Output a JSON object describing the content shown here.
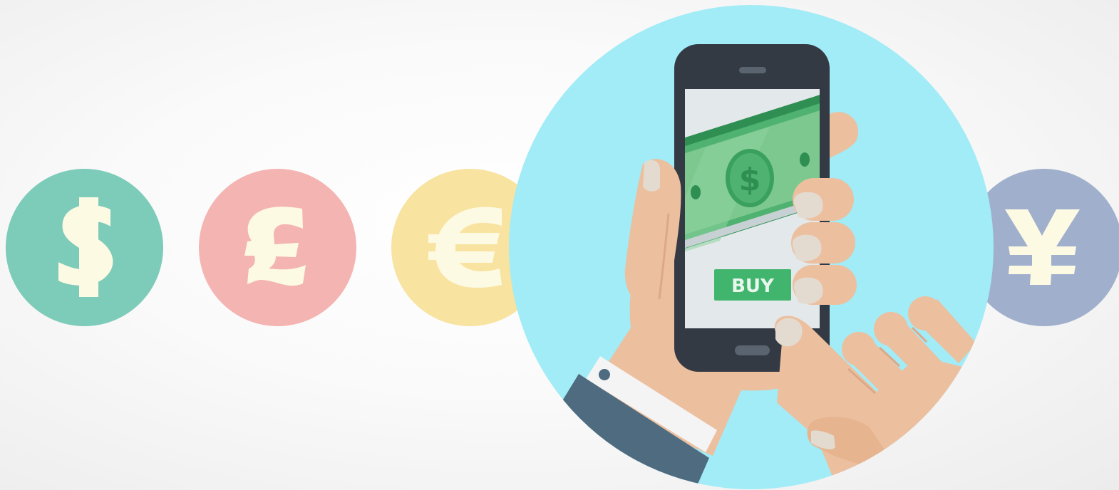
{
  "colors": {
    "background": "#f5f5f5",
    "dollar_coin": "#7dcbb9",
    "pound_coin": "#f4b4b2",
    "euro_coin": "#f8e3a0",
    "yen_coin": "#a0b0cc",
    "symbol": "#fdfae4",
    "main_circle": "#a1ecf6",
    "phone_body": "#333a44",
    "phone_screen": "#e3e8ea",
    "banknote": "#4fb271",
    "buy_button": "#41b56e",
    "skin": "#ecbf9f",
    "sleeve": "#4e6b80",
    "cuff": "#f4f4f4"
  },
  "coins": [
    {
      "name": "dollar",
      "icon": "dollar-sign-icon"
    },
    {
      "name": "pound",
      "icon": "pound-sign-icon"
    },
    {
      "name": "euro",
      "icon": "euro-sign-icon"
    },
    {
      "name": "yen",
      "icon": "yen-sign-icon"
    }
  ],
  "phone": {
    "banknote_icon": "dollar-banknote-icon",
    "buy_button_label": "BUY"
  }
}
